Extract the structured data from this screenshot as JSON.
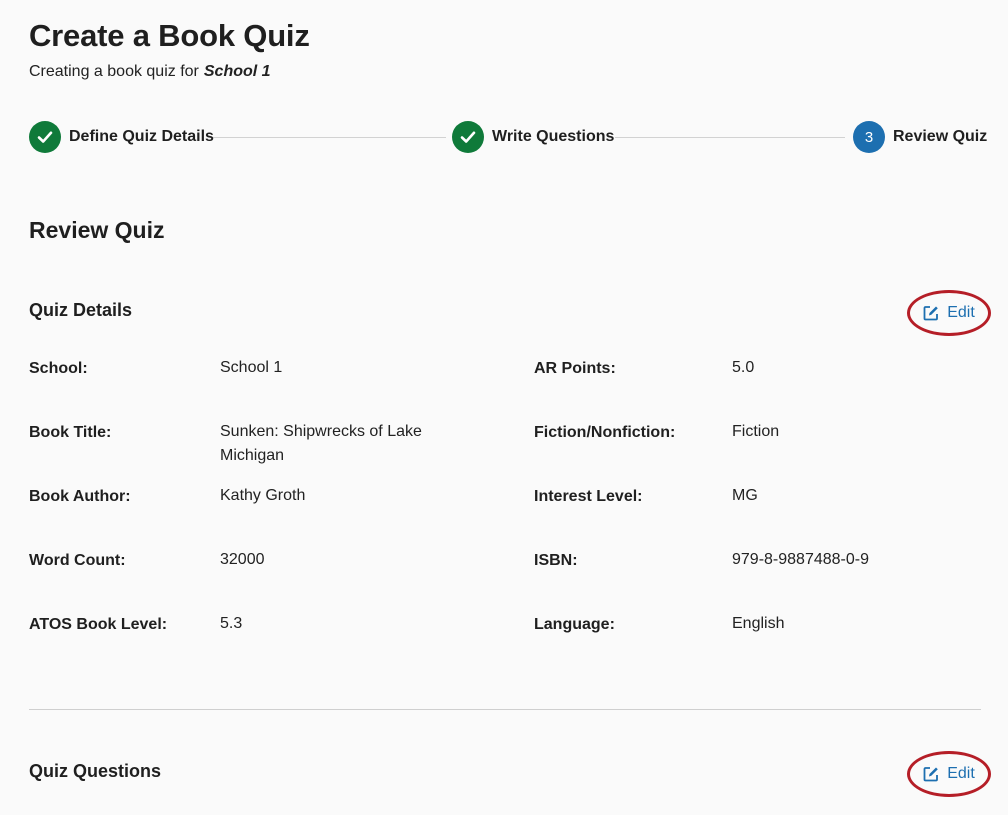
{
  "page": {
    "title": "Create a Book Quiz",
    "subtitle_prefix": "Creating a book quiz for",
    "school_name": "School 1"
  },
  "stepper": {
    "steps": [
      {
        "label": "Define Quiz Details",
        "state": "complete",
        "icon": "check-icon"
      },
      {
        "label": "Write Questions",
        "state": "complete",
        "icon": "check-icon"
      },
      {
        "label": "Review Quiz",
        "state": "current",
        "number": "3"
      }
    ]
  },
  "review": {
    "heading": "Review Quiz",
    "quiz_details": {
      "heading": "Quiz Details",
      "edit_label": "Edit",
      "fields": [
        {
          "label": "School:",
          "value": "School 1"
        },
        {
          "label": "AR Points:",
          "value": "5.0"
        },
        {
          "label": "Book Title:",
          "value": "Sunken: Shipwrecks of Lake Michigan"
        },
        {
          "label": "Fiction/Nonfiction:",
          "value": "Fiction"
        },
        {
          "label": "Book Author:",
          "value": "Kathy Groth"
        },
        {
          "label": "Interest Level:",
          "value": "MG"
        },
        {
          "label": "Word Count:",
          "value": "32000"
        },
        {
          "label": "ISBN:",
          "value": "979-8-9887488-0-9"
        },
        {
          "label": "ATOS Book Level:",
          "value": "5.3"
        },
        {
          "label": "Language:",
          "value": "English"
        }
      ]
    },
    "quiz_questions": {
      "heading": "Quiz Questions",
      "edit_label": "Edit"
    }
  },
  "colors": {
    "complete": "#0f7a3a",
    "current": "#1d6fb0",
    "highlight_ring": "#b51e27",
    "link": "#1d6fb0"
  }
}
